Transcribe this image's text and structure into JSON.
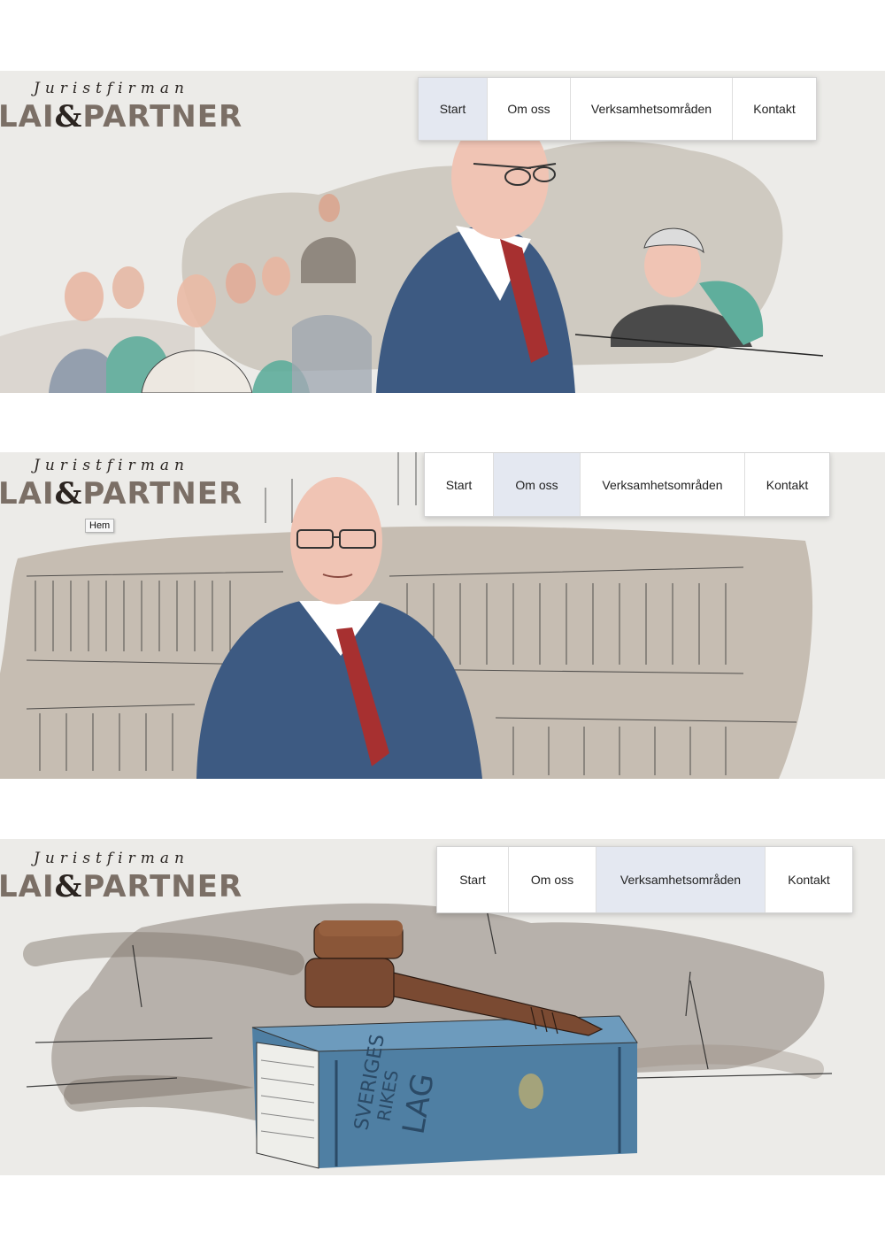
{
  "logo": {
    "tagline": "Juristfirman",
    "name_left": "LAI",
    "ampersand": "&",
    "name_right": "PARTNER"
  },
  "panels": [
    {
      "nav": [
        {
          "label": "Start",
          "active": true
        },
        {
          "label": "Om oss",
          "active": false
        },
        {
          "label": "Verksamhetsområden",
          "active": false
        },
        {
          "label": "Kontakt",
          "active": false
        }
      ],
      "illustration": "courtroom-scene"
    },
    {
      "nav": [
        {
          "label": "Start",
          "active": false
        },
        {
          "label": "Om oss",
          "active": true
        },
        {
          "label": "Verksamhetsområden",
          "active": false
        },
        {
          "label": "Kontakt",
          "active": false
        }
      ],
      "tooltip": "Hem",
      "illustration": "lawyer-portrait"
    },
    {
      "nav": [
        {
          "label": "Start",
          "active": false
        },
        {
          "label": "Om oss",
          "active": false
        },
        {
          "label": "Verksamhetsområden",
          "active": true
        },
        {
          "label": "Kontakt",
          "active": false
        }
      ],
      "illustration": "gavel-on-lawbook",
      "book_title": "SVERIGES RIKES LAG"
    }
  ],
  "colors": {
    "panel_bg": "#ecebe8",
    "nav_active_bg": "#e4e8f1",
    "suit_blue": "#3d5a82",
    "wash_brown": "#a99c8c",
    "gavel_brown": "#7a4a32",
    "book_blue": "#4f7fa3",
    "teal": "#5fae9c",
    "tie_red": "#a73030"
  }
}
